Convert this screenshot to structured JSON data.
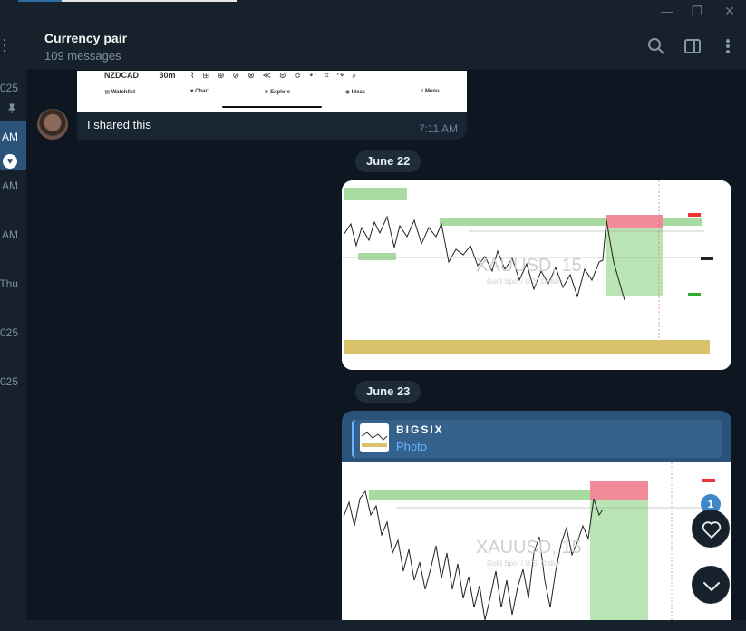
{
  "window": {
    "controls": [
      "minimize-icon",
      "restore-icon",
      "close-icon"
    ]
  },
  "chat_list_strip": {
    "items": [
      {
        "time": "025"
      },
      {
        "time": "AM",
        "active": true
      },
      {
        "time": "AM"
      },
      {
        "time": "AM"
      },
      {
        "time": "Thu"
      },
      {
        "time": "025"
      },
      {
        "time": "025"
      }
    ]
  },
  "header": {
    "title": "Currency pair",
    "subtitle": "109 messages"
  },
  "messages": {
    "first": {
      "toolbar_symbol": "NZDCAD",
      "toolbar_interval": "30m",
      "nav": [
        "Watchlist",
        "Chart",
        "Explore",
        "Ideas",
        "Menu"
      ],
      "text": "I shared this",
      "time": "7:11 AM"
    },
    "date1": "June 22",
    "date2": "June 23",
    "chart1": {
      "watermark": "XAUUSD, 15",
      "sub": "Gold Spot / U.S. Dollar"
    },
    "forward": {
      "sender": "BIGSIX",
      "kind": "Photo"
    },
    "chart2": {
      "watermark": "XAUUSD, 15",
      "sub": "Gold Spot / U.S. Dollar"
    }
  },
  "reactions": {
    "badge_count": "1"
  },
  "colors": {
    "background": "#0e1621",
    "panel": "#17212b",
    "outgoing": "#2b5278",
    "accent": "#6cb4ff"
  }
}
